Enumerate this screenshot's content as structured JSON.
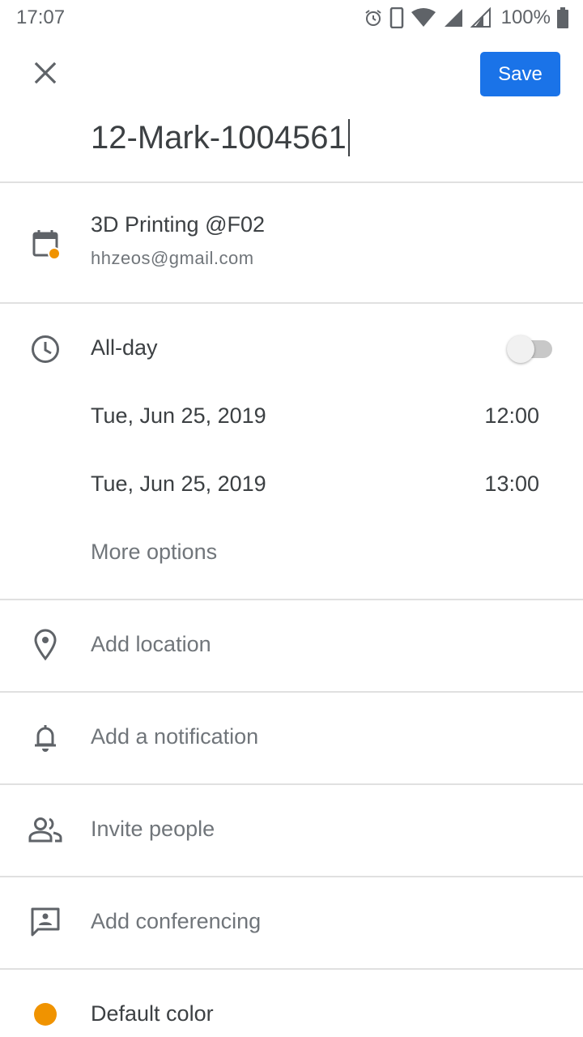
{
  "status_bar": {
    "time": "17:07",
    "battery_percent": "100%",
    "icons": [
      "alarm-icon",
      "phone-icon",
      "wifi-icon",
      "signal-icon",
      "signal-roaming-icon",
      "battery-icon"
    ]
  },
  "toolbar": {
    "close_icon": "close-icon",
    "save_label": "Save"
  },
  "event": {
    "title": "12-Mark-1004561",
    "calendar_name": "3D Printing @F02",
    "calendar_email": "hhzeos@gmail.com",
    "calendar_color": "#f09300"
  },
  "time_section": {
    "all_day_label": "All-day",
    "all_day_enabled": false,
    "start_date": "Tue, Jun 25, 2019",
    "start_time": "12:00",
    "end_date": "Tue, Jun 25, 2019",
    "end_time": "13:00",
    "more_options": "More options"
  },
  "rows": {
    "location": "Add location",
    "notification": "Add a notification",
    "invite": "Invite people",
    "conferencing": "Add conferencing",
    "color": "Default color"
  },
  "colors": {
    "accent": "#1a73e8",
    "event_color": "#f09300"
  }
}
